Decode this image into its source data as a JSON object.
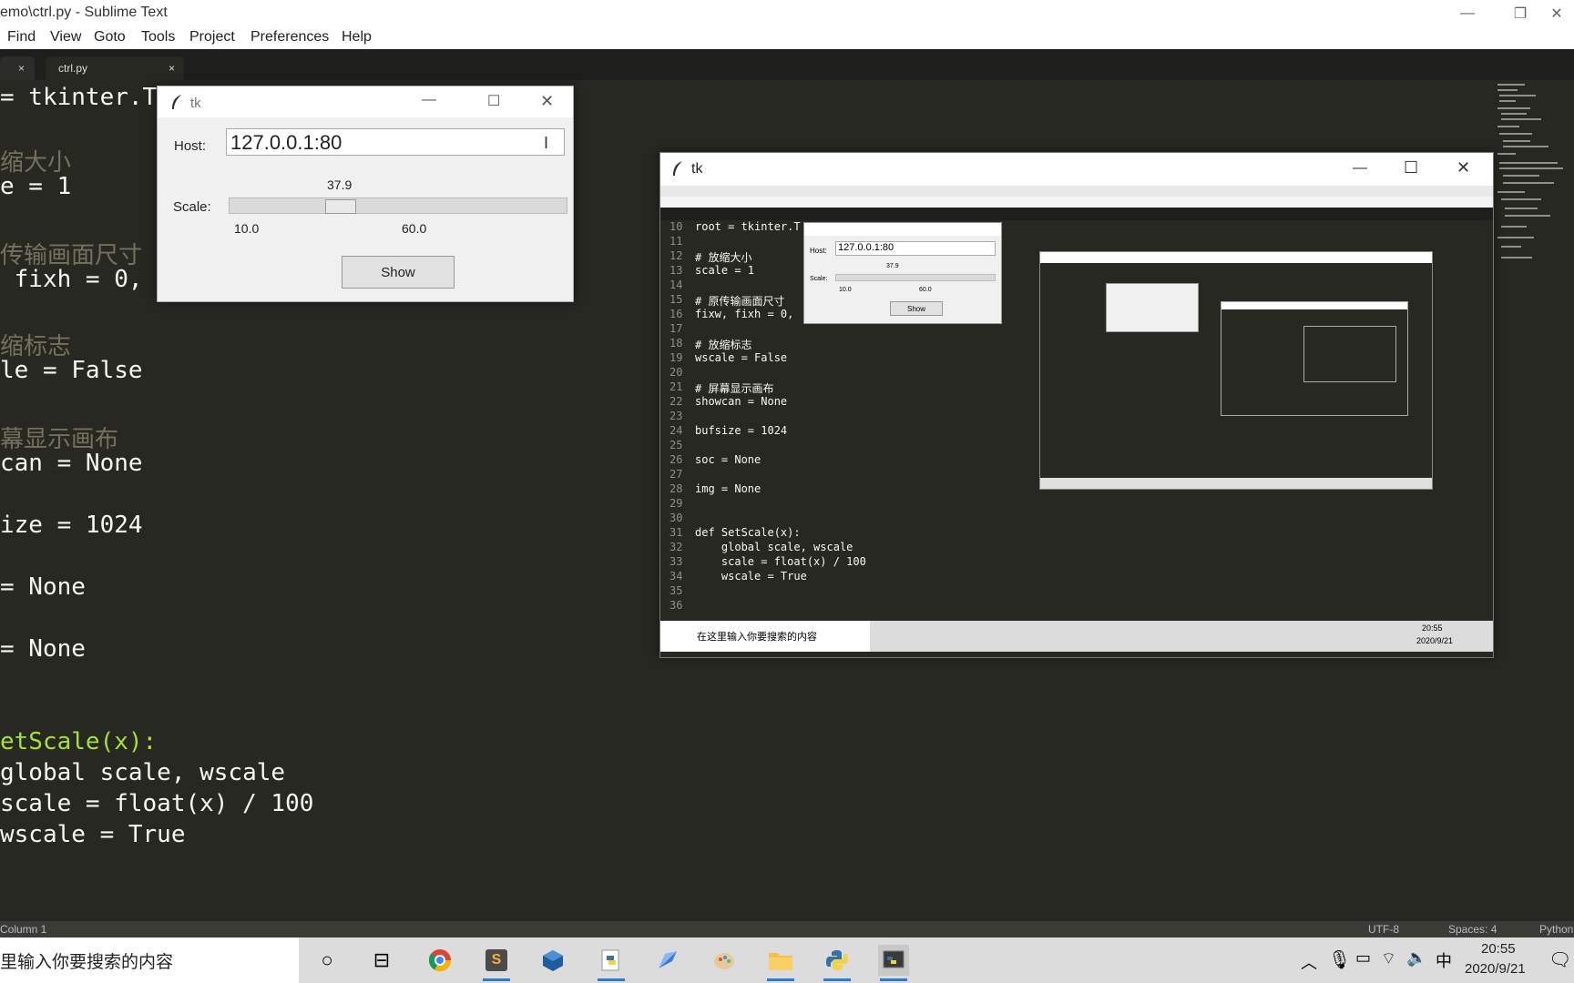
{
  "window": {
    "title": "emo\\ctrl.py - Sublime Text"
  },
  "menu": [
    "Find",
    "View",
    "Goto",
    "Tools",
    "Project",
    "Preferences",
    "Help"
  ],
  "tabs": {
    "close_glyph": "×",
    "active": "ctrl.py"
  },
  "editor_lines": {
    "l1_var": "= tkinter.T",
    "l2_cmt": "缩大小",
    "l3_var": "e = 1",
    "l4_cmt": "传输画面尺寸",
    "l5_var": " fixh = 0,",
    "l6_cmt": "缩标志",
    "l7_var": "le = False",
    "l8_cmt": "幕显示画布",
    "l9_var": "can = None",
    "l10_var": "ize = 1024",
    "l11_var": "= None",
    "l12_var": "= None",
    "l13_def": "etScale(x):",
    "l14": "global scale, wscale",
    "l15": "scale = float(x) / 100",
    "l16": "wscale = True"
  },
  "status": {
    "left": "Column 1",
    "encoding": "UTF-8",
    "indent": "Spaces: 4",
    "syntax": "Python"
  },
  "taskbar": {
    "search_text": "里输入你要搜索的内容",
    "ime": "中",
    "time": "20:55",
    "date": "2020/9/21"
  },
  "tk_small": {
    "title": "tk",
    "host_label": "Host:",
    "host_value": "127.0.0.1:80",
    "scale_label": "Scale:",
    "scale_value": "37.9",
    "scale_min": "10.0",
    "scale_max": "60.0",
    "show_label": "Show"
  },
  "tk_big": {
    "title": "tk",
    "inner_host": "127.0.0.1:80",
    "inner_scale_value": "37.9",
    "inner_min": "10.0",
    "inner_max": "60.0",
    "inner_show": "Show",
    "search_text": "在这里输入你要搜索的内容",
    "time": "20:55",
    "date": "2020/9/21",
    "line_numbers": [
      "10",
      "11",
      "12",
      "13",
      "14",
      "15",
      "16",
      "17",
      "18",
      "19",
      "20",
      "21",
      "22",
      "23",
      "24",
      "25",
      "26",
      "27",
      "28",
      "29",
      "30",
      "31",
      "32",
      "33",
      "34",
      "35",
      "36"
    ],
    "code": {
      "l10": "root = tkinter.T",
      "l12": "# 放缩大小",
      "l13": "scale = 1",
      "l15": "# 原传输画面尺寸",
      "l16": "fixw, fixh = 0,",
      "l18": "# 放缩标志",
      "l19": "wscale = False",
      "l21": "# 屏幕显示画布",
      "l22": "showcan = None",
      "l24": "bufsize = 1024",
      "l26": "soc = None",
      "l28": "img = None",
      "l31": "def SetScale(x):",
      "l32": "    global scale, wscale",
      "l33": "    scale = float(x) / 100",
      "l34": "    wscale = True"
    }
  }
}
